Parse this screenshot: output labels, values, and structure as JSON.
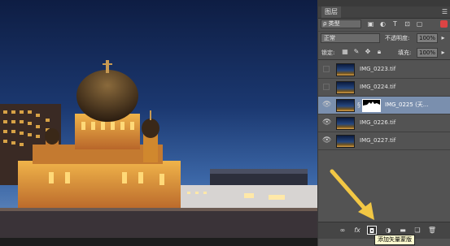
{
  "layers_panel": {
    "tab_label": "图层",
    "menu_icon": "panel-menu-icon",
    "filter": {
      "selected": "ρ 类型"
    },
    "blend": {
      "mode": "正常",
      "opacity_label": "不透明度:",
      "opacity_value": "100%"
    },
    "lock": {
      "label": "锁定:",
      "fill_label": "填充:",
      "fill_value": "100%"
    },
    "layers": [
      {
        "name": "IMG_0223.tif",
        "visible": false,
        "selected": false,
        "has_mask": false
      },
      {
        "name": "IMG_0224.tif",
        "visible": false,
        "selected": false,
        "has_mask": false
      },
      {
        "name": "IMG_0225 (天...",
        "visible": true,
        "selected": true,
        "has_mask": true
      },
      {
        "name": "IMG_0226.tif",
        "visible": true,
        "selected": false,
        "has_mask": false
      },
      {
        "name": "IMG_0227.tif",
        "visible": true,
        "selected": false,
        "has_mask": false
      }
    ],
    "footer_buttons": [
      "link-layers-icon",
      "fx-icon",
      "add-mask-icon",
      "adjustment-icon",
      "folder-icon",
      "new-layer-icon",
      "trash-icon"
    ],
    "tooltip": "添加矢量蒙版"
  },
  "annotation": {
    "arrow_color": "#f2c744"
  },
  "colors": {
    "panel_bg": "#535353",
    "selected_layer": "#7a8fae",
    "tooltip_bg": "#fffcd0"
  }
}
